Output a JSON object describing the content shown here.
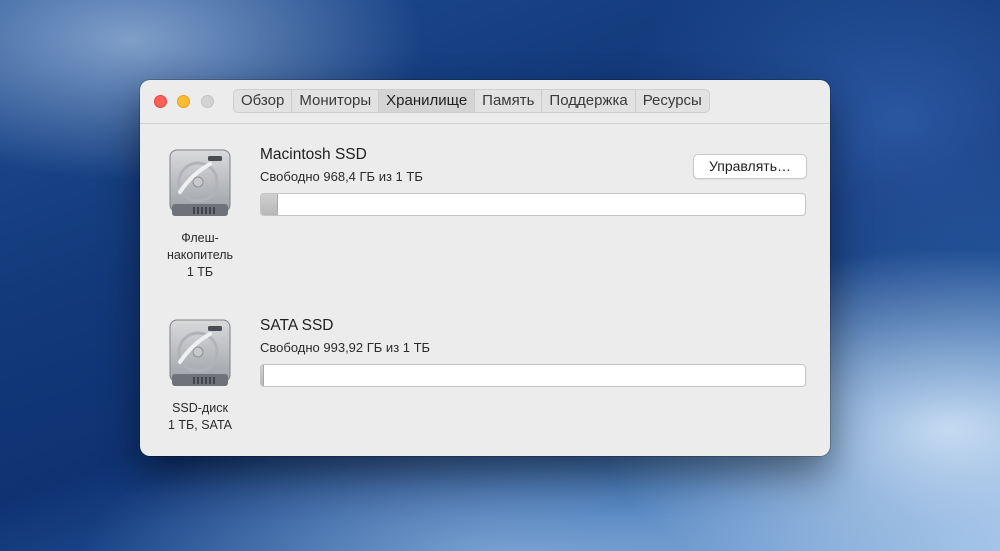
{
  "tabs": [
    {
      "label": "Обзор"
    },
    {
      "label": "Мониторы"
    },
    {
      "label": "Хранилище"
    },
    {
      "label": "Память"
    },
    {
      "label": "Поддержка"
    },
    {
      "label": "Ресурсы"
    }
  ],
  "active_tab": "Хранилище",
  "manage_button": "Управлять…",
  "disks": [
    {
      "icon": "hard-drive-icon",
      "caption": [
        "Флеш-",
        "накопитель",
        "1 ТБ"
      ],
      "name": "Macintosh SSD",
      "free": "Свободно 968,4 ГБ из 1 ТБ",
      "used_fraction": 0.032
    },
    {
      "icon": "hard-drive-icon",
      "caption": [
        "SSD-диск",
        "1 ТБ, SATA"
      ],
      "name": "SATA SSD",
      "free": "Свободно 993,92 ГБ из 1 ТБ",
      "used_fraction": 0.006
    }
  ],
  "colors": {
    "window_bg": "#ececec",
    "close": "#ff5f57",
    "minimize": "#febc2e",
    "zoom_disabled": "#d3d3d3"
  }
}
